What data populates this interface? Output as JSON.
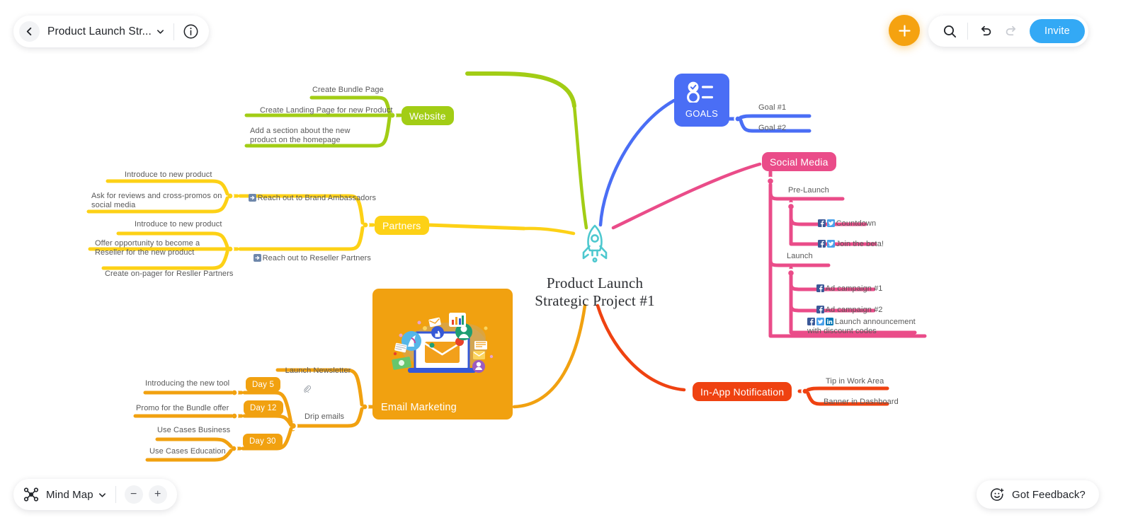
{
  "app": {
    "title": "Product Launch Str...",
    "mode_label": "Mind Map",
    "feedback_label": "Got Feedback?",
    "invite_label": "Invite",
    "zoom_out_label": "−",
    "zoom_in_label": "+",
    "icons": {
      "back": "chevron-left-icon",
      "dropdown": "chevron-down-icon",
      "info": "info-icon",
      "add": "plus-icon",
      "search": "search-icon",
      "undo": "undo-icon",
      "redo": "redo-icon",
      "mindmap": "mindmap-icon",
      "feedback": "smiley-plus-icon"
    }
  },
  "colors": {
    "green": "#a2cd15",
    "yellow": "#fdd116",
    "orange": "#f1a110",
    "red": "#ef4211",
    "pink": "#ea4c89",
    "blue": "#4a6ef5",
    "teal": "#4dc8cf",
    "accent_orange": "#f5a210",
    "invite_blue": "#33a9f5",
    "label_gray": "#595959"
  },
  "center": {
    "title_line1": "Product Launch",
    "title_line2": "Strategic Project #1",
    "icon": "rocket-icon"
  },
  "branches": {
    "goals": {
      "label": "GOALS",
      "icon": "checklist-icon",
      "children": [
        {
          "label": "Goal #1"
        },
        {
          "label": "Goal #2"
        }
      ]
    },
    "social_media": {
      "label": "Social Media",
      "groups": [
        {
          "label": "Pre-Launch",
          "items": [
            {
              "label": "Countdown",
              "icons": [
                "facebook-icon",
                "twitter-icon"
              ]
            },
            {
              "label": "Join the beta!",
              "icons": [
                "facebook-icon",
                "twitter-icon"
              ]
            }
          ]
        },
        {
          "label": "Launch",
          "items": [
            {
              "label": "Ad campaign #1",
              "icons": [
                "facebook-icon"
              ]
            },
            {
              "label": "Ad campaign #2",
              "icons": [
                "facebook-icon"
              ]
            },
            {
              "label": "Launch announcement with discount codes",
              "icons": [
                "facebook-icon",
                "twitter-icon",
                "linkedin-icon"
              ]
            }
          ]
        }
      ]
    },
    "in_app_notification": {
      "label": "In-App Notification",
      "children": [
        {
          "label": "Tip in Work Area"
        },
        {
          "label": "Banner in Dashboard"
        }
      ]
    },
    "website": {
      "label": "Website",
      "children": [
        {
          "label": "Create Bundle Page"
        },
        {
          "label": "Create Landing Page for new Product"
        },
        {
          "label": "Add a section about the new product on the homepage"
        }
      ]
    },
    "partners": {
      "label": "Partners",
      "groups": [
        {
          "label": "Reach out to Brand Ambassadors",
          "icon": "arrow-right-badge-icon",
          "items": [
            {
              "label": "Introduce to new product"
            },
            {
              "label": "Ask for reviews and cross-promos on social media"
            }
          ]
        },
        {
          "label": "Reach out to Reseller Partners",
          "icon": "arrow-right-badge-icon",
          "items": [
            {
              "label": "Introduce to new product"
            },
            {
              "label": "Offer opportunity to become a Reseller for the new product"
            },
            {
              "label": "Create on-pager for Resller Partners"
            }
          ]
        }
      ]
    },
    "email_marketing": {
      "label": "Email Marketing",
      "illustration": "email-marketing-illustration",
      "children": [
        {
          "label": "Launch Newsletter",
          "icon": "attachment-icon"
        },
        {
          "label": "Drip emails",
          "items": [
            {
              "badge": "Day 5",
              "label": "Introducing the new tool"
            },
            {
              "badge": "Day 12",
              "label": "Promo for the Bundle offer"
            },
            {
              "badge": "Day 30",
              "labels": [
                "Use Cases Business",
                "Use Cases Education"
              ]
            }
          ]
        }
      ]
    }
  }
}
